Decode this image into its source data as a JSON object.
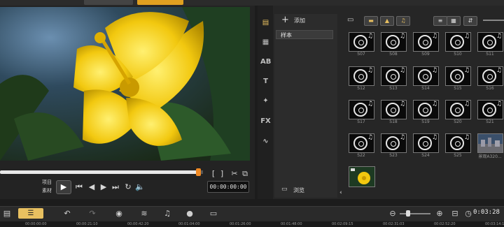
{
  "toolbar_top": {
    "tabs": [
      "",
      ""
    ]
  },
  "preview": {
    "mode_project": "项目",
    "mode_clip": "素材",
    "timecode": "00:00:00:00",
    "bracket_in": "[",
    "bracket_out": "]"
  },
  "library": {
    "add_label": "添加",
    "folder_name": "样本",
    "browse_label": "浏览",
    "thumbs": [
      "S07",
      "S08",
      "S09",
      "S10",
      "S11",
      "S12",
      "S13",
      "S14",
      "S15",
      "S16",
      "S17",
      "S18",
      "S19",
      "S20",
      "S21",
      "S22",
      "S23",
      "S24",
      "S25",
      "景观A320..."
    ]
  },
  "timeline": {
    "project_time": "0:03:28",
    "ruler": [
      "00:00:00:00",
      "00:00:21:10",
      "00:00:42:20",
      "00:01:04:00",
      "00:01:26:00",
      "00:01:48:00",
      "00:02:09:15",
      "00:02:31:03",
      "00:02:52:20",
      "00:03:14:15"
    ]
  },
  "colors": {
    "accent": "#f08a24",
    "panel": "#262626",
    "flower": "#f2c80f"
  }
}
